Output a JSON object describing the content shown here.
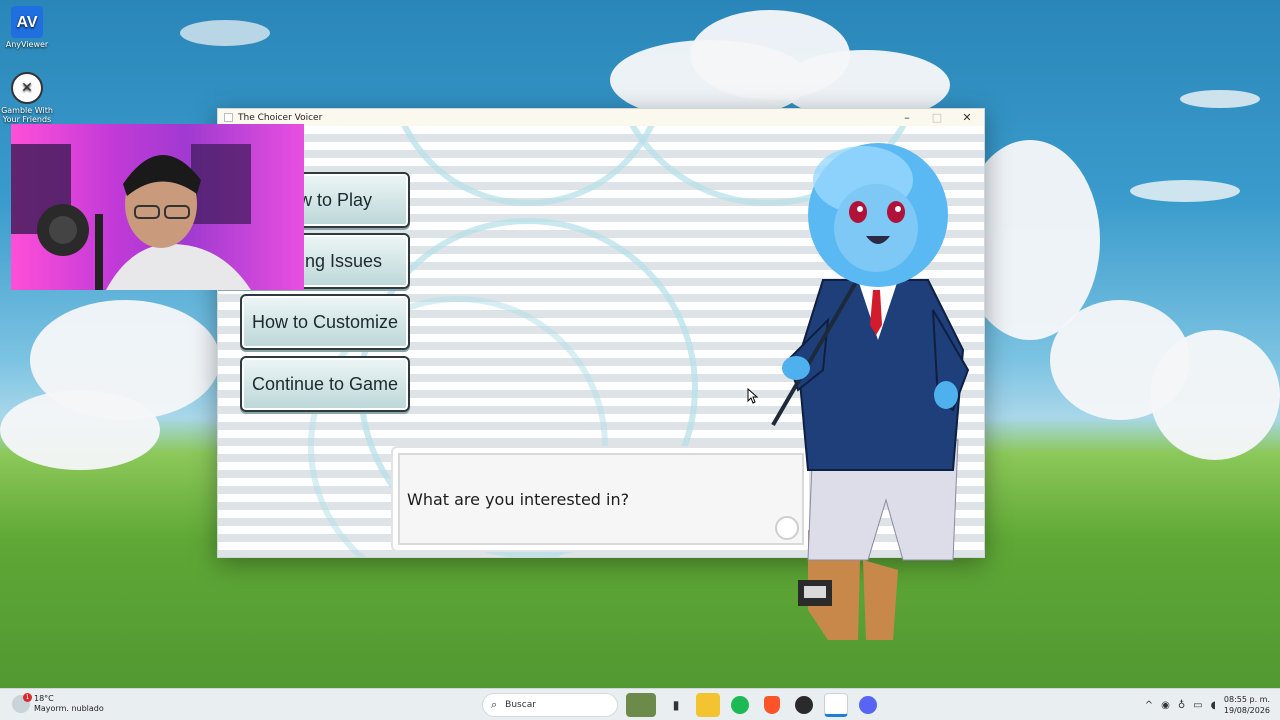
{
  "desktop": {
    "icons": [
      {
        "label": "AnyViewer",
        "icon": "anyviewer-icon"
      },
      {
        "label": "Gamble With Your Friends",
        "icon": "gamble-game-icon"
      }
    ]
  },
  "window": {
    "title": "The Choicer Voicer",
    "controls": {
      "minimize": "–",
      "maximize": "□",
      "close": "✕"
    }
  },
  "menu": {
    "buttons": [
      {
        "label": "w to Play"
      },
      {
        "label": "ing Issues"
      },
      {
        "label": "How to Customize"
      },
      {
        "label": "Continue to Game"
      }
    ]
  },
  "dialog": {
    "text": "What are you interested in?"
  },
  "taskbar": {
    "weather": {
      "temp": "18°C",
      "desc": "Mayorm. nublado",
      "badge": "1"
    },
    "search_placeholder": "Buscar",
    "apps": [
      "desert-wallpaper-icon",
      "terminal-icon",
      "file-explorer-icon",
      "spotify-icon",
      "brave-icon",
      "obs-icon",
      "notepad-icon",
      "discord-icon"
    ],
    "clock": {
      "time": "08:55 p. m.",
      "date": "19/08/2026"
    },
    "colors": {
      "accent": "#1c7fd6",
      "spotify": "#1db954",
      "brave": "#fb542b",
      "discord": "#5865f2"
    }
  }
}
